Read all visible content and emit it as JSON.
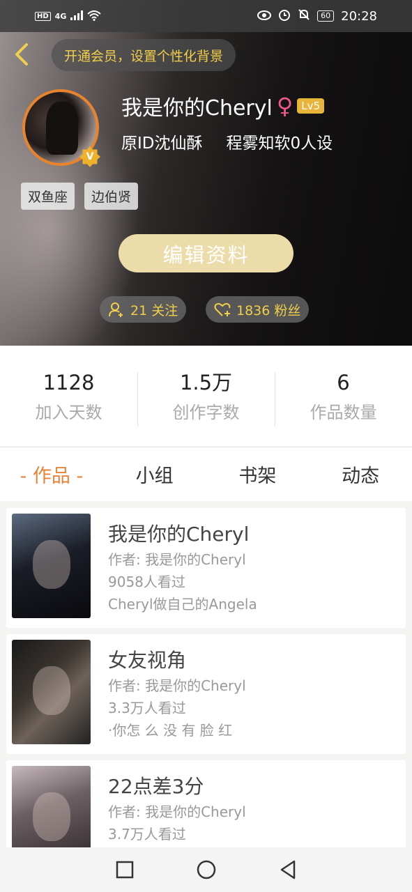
{
  "status_bar": {
    "network": "4G",
    "hd": "HD",
    "battery": "60",
    "time": "20:28"
  },
  "header": {
    "vip_banner": "开通会员，设置个性化背景",
    "nickname": "我是你的Cheryl",
    "gender_icon": "female-symbol",
    "level": "Lv5",
    "verified_badge": "V",
    "bio_1": "原ID沈仙酥",
    "bio_2": "程雾知软0人设",
    "tags": [
      "双鱼座",
      "边伯贤"
    ],
    "edit_button": "编辑资料",
    "follow_text": "21 关注",
    "fans_text": "1836 粉丝"
  },
  "stats": [
    {
      "value": "1128",
      "label": "加入天数"
    },
    {
      "value": "1.5万",
      "label": "创作字数"
    },
    {
      "value": "6",
      "label": "作品数量"
    }
  ],
  "tabs": [
    {
      "label": "- 作品 -",
      "active": true
    },
    {
      "label": "小组",
      "active": false
    },
    {
      "label": "书架",
      "active": false
    },
    {
      "label": "动态",
      "active": false
    }
  ],
  "works": [
    {
      "title": "我是你的Cheryl",
      "author": "作者: 我是你的Cheryl",
      "views": "9058人看过",
      "desc": "Cheryl做自己的Angela"
    },
    {
      "title": "女友视角",
      "author": "作者: 我是你的Cheryl",
      "views": "3.3万人看过",
      "desc": "·你怎 么 没 有 脸 红"
    },
    {
      "title": "22点差3分",
      "author": "作者: 我是你的Cheryl",
      "views": "3.7万人看过",
      "desc": ""
    }
  ],
  "colors": {
    "accent": "#e8833a",
    "gold": "#f2cf4a",
    "edit_button": "#ecdcaa"
  }
}
